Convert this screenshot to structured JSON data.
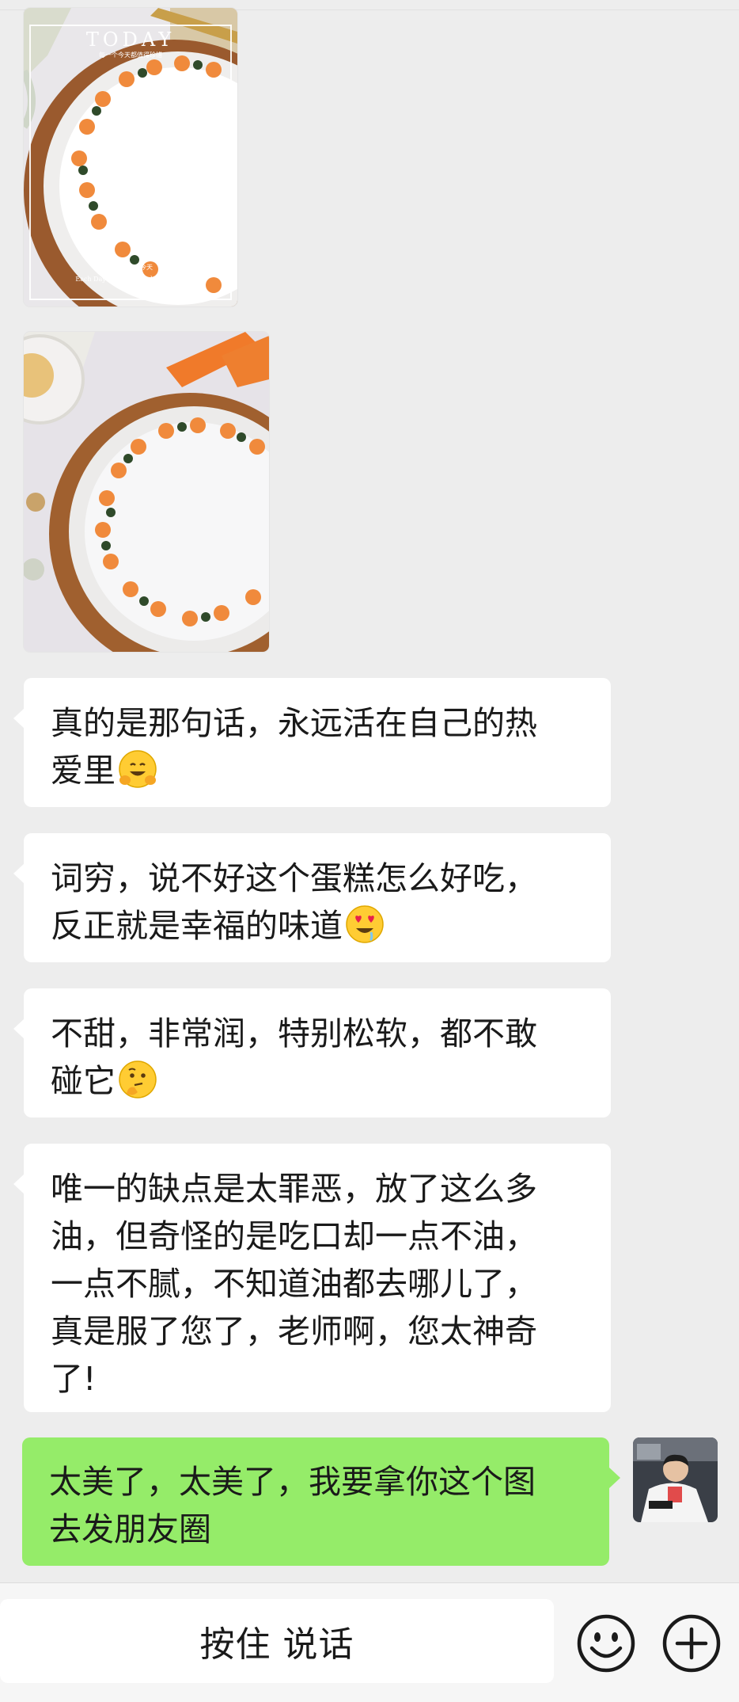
{
  "messages": [
    {
      "type": "image",
      "sender": "other",
      "overlay_title": "TODAY",
      "overlay_subtitle": "每一个今天都值得珍惜",
      "overlay_caption_1": "珍惜每一个今天",
      "overlay_caption_2": "Each Day Worth Cherishing Today"
    },
    {
      "type": "image",
      "sender": "other"
    },
    {
      "type": "text",
      "sender": "other",
      "lines": [
        "真的是那句话，永远活在自己的热",
        "爱里"
      ],
      "emoji": "hugging-face"
    },
    {
      "type": "text",
      "sender": "other",
      "lines": [
        "词穷，说不好这个蛋糕怎么好吃，",
        "反正就是幸福的味道"
      ],
      "emoji": "heart-eyes-drooling-face"
    },
    {
      "type": "text",
      "sender": "other",
      "lines": [
        "不甜，非常润，特别松软，都不敢",
        "碰它"
      ],
      "emoji": "thinking-face"
    },
    {
      "type": "text",
      "sender": "other",
      "lines": [
        "唯一的缺点是太罪恶，放了这么多",
        "油，但奇怪的是吃口却一点不油，",
        "一点不腻，不知道油都去哪儿了，",
        "真是服了您了，老师啊，您太神奇",
        "了!"
      ]
    },
    {
      "type": "text",
      "sender": "self",
      "lines": [
        "太美了，太美了，我要拿你这个图",
        "去发朋友圈"
      ]
    }
  ],
  "input_bar": {
    "talk_label": "按住 说话",
    "emoji_icon": "smile-icon",
    "plus_icon": "plus-icon"
  },
  "colors": {
    "background": "#ededed",
    "incoming_bubble": "#ffffff",
    "outgoing_bubble": "#95ec69"
  }
}
